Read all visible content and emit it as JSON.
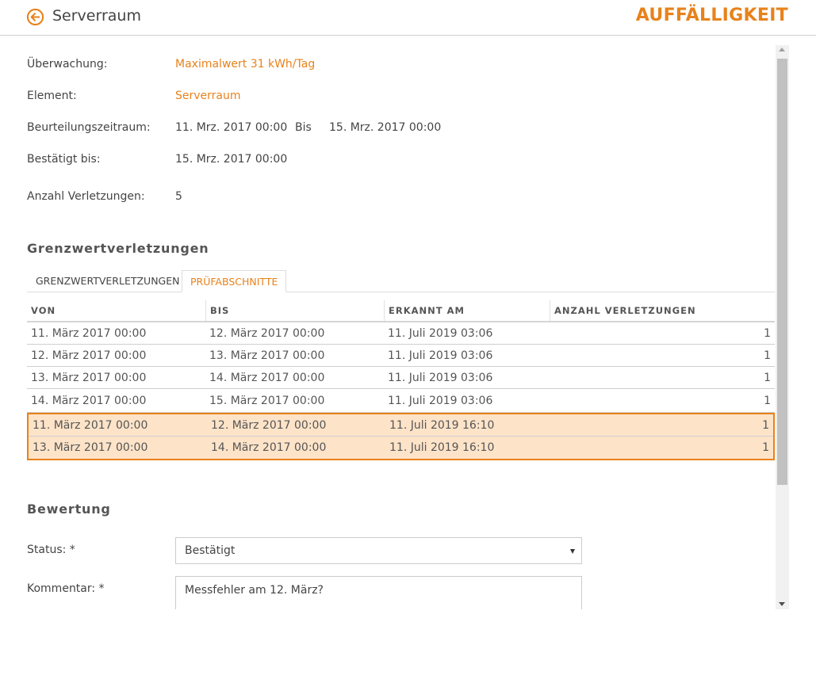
{
  "header": {
    "title": "Serverraum",
    "badge": "AUFFÄLLIGKEIT"
  },
  "colors": {
    "accent": "#e8821b",
    "selected_row_bg": "#fde3c8"
  },
  "info": {
    "monitoring_label": "Überwachung:",
    "monitoring_value": "Maximalwert 31 kWh/Tag",
    "element_label": "Element:",
    "element_value": "Serverraum",
    "period_label": "Beurteilungszeitraum:",
    "period_from": "11. Mrz. 2017 00:00",
    "period_sep": "Bis",
    "period_to": "15. Mrz. 2017 00:00",
    "confirmed_label": "Bestätigt bis:",
    "confirmed_value": "15. Mrz. 2017 00:00",
    "violations_label": "Anzahl Verletzungen:",
    "violations_value": "5"
  },
  "violations": {
    "title": "Grenzwertverletzungen",
    "tabs": [
      {
        "label": "GRENZWERTVERLETZUNGEN",
        "active": false
      },
      {
        "label": "PRÜFABSCHNITTE",
        "active": true
      }
    ],
    "columns": [
      "VON",
      "BIS",
      "ERKANNT AM",
      "ANZAHL VERLETZUNGEN"
    ],
    "rows": [
      {
        "von": "11. März 2017 00:00",
        "bis": "12. März 2017 00:00",
        "erkannt": "11. Juli 2019 03:06",
        "anzahl": "1",
        "selected": false
      },
      {
        "von": "12. März 2017 00:00",
        "bis": "13. März 2017 00:00",
        "erkannt": "11. Juli 2019 03:06",
        "anzahl": "1",
        "selected": false
      },
      {
        "von": "13. März 2017 00:00",
        "bis": "14. März 2017 00:00",
        "erkannt": "11. Juli 2019 03:06",
        "anzahl": "1",
        "selected": false
      },
      {
        "von": "14. März 2017 00:00",
        "bis": "15. März 2017 00:00",
        "erkannt": "11. Juli 2019 03:06",
        "anzahl": "1",
        "selected": false
      },
      {
        "von": "11. März 2017 00:00",
        "bis": "12. März 2017 00:00",
        "erkannt": "11. Juli 2019 16:10",
        "anzahl": "1",
        "selected": true
      },
      {
        "von": "13. März 2017 00:00",
        "bis": "14. März 2017 00:00",
        "erkannt": "11. Juli 2019 16:10",
        "anzahl": "1",
        "selected": true
      }
    ]
  },
  "rating": {
    "title": "Bewertung",
    "status_label": "Status: *",
    "status_value": "Bestätigt",
    "comment_label": "Kommentar: *",
    "comment_value": "Messfehler am 12. März?"
  }
}
